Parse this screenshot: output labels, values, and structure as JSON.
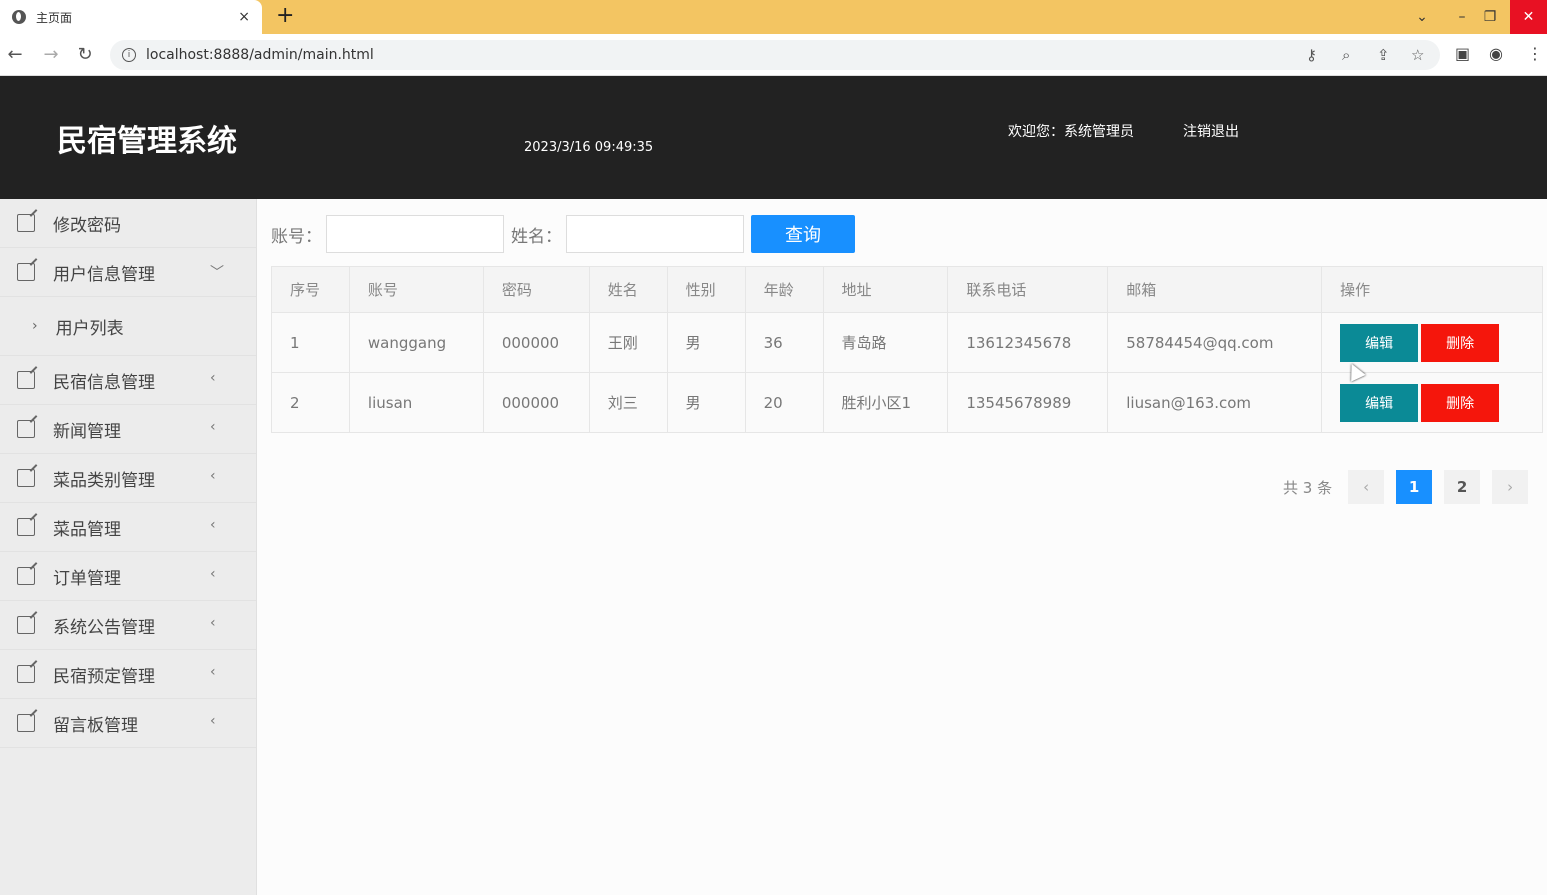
{
  "browser": {
    "tab_title": "主页面",
    "tab_close": "×",
    "new_tab": "+",
    "url": "localhost:8888/admin/main.html"
  },
  "header": {
    "app_title": "民宿管理系统",
    "datetime": "2023/3/16 09:49:35",
    "welcome": "欢迎您：系统管理员",
    "logout": "注销退出"
  },
  "sidebar": {
    "items": [
      {
        "label": "修改密码"
      },
      {
        "label": "用户信息管理"
      },
      {
        "label": "用户列表"
      },
      {
        "label": "民宿信息管理"
      },
      {
        "label": "新闻管理"
      },
      {
        "label": "菜品类别管理"
      },
      {
        "label": "菜品管理"
      },
      {
        "label": "订单管理"
      },
      {
        "label": "系统公告管理"
      },
      {
        "label": "民宿预定管理"
      },
      {
        "label": "留言板管理"
      }
    ]
  },
  "search": {
    "account_label": "账号：",
    "name_label": "姓名：",
    "account_value": "",
    "name_value": "",
    "button": "查询"
  },
  "table": {
    "headers": [
      "序号",
      "账号",
      "密码",
      "姓名",
      "性别",
      "年龄",
      "地址",
      "联系电话",
      "邮箱",
      "操作"
    ],
    "rows": [
      {
        "idx": "1",
        "account": "wanggang",
        "password": "000000",
        "name": "王刚",
        "gender": "男",
        "age": "36",
        "address": "青岛路",
        "phone": "13612345678",
        "email": "58784454@qq.com"
      },
      {
        "idx": "2",
        "account": "liusan",
        "password": "000000",
        "name": "刘三",
        "gender": "男",
        "age": "20",
        "address": "胜利小区1",
        "phone": "13545678989",
        "email": "liusan@163.com"
      }
    ],
    "edit_label": "编辑",
    "delete_label": "删除"
  },
  "pagination": {
    "total": "共 3 条",
    "prev": "‹",
    "pages": [
      "1",
      "2"
    ],
    "next": "›",
    "current": "1"
  },
  "colors": {
    "accent": "#1890ff",
    "edit": "#0b8a96",
    "delete": "#f5160c",
    "header_bg": "#222222",
    "tabbar_bg": "#f3c562"
  }
}
